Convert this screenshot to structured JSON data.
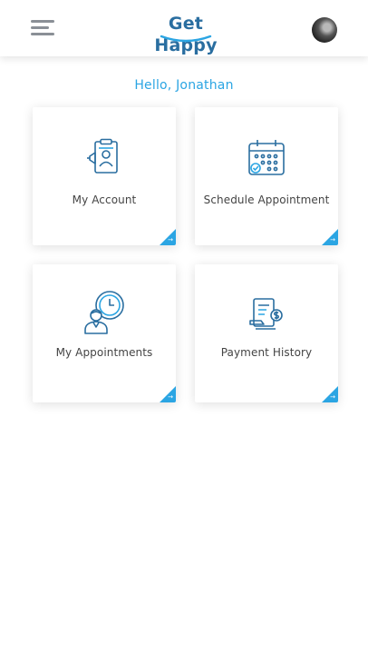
{
  "header": {
    "logo_text": "Get Happy",
    "menu_icon": "hamburger-menu-icon",
    "avatar_icon": "user-avatar"
  },
  "greeting": "Hello, Jonathan",
  "tiles": [
    {
      "label": "My Account",
      "icon": "account-id-card-icon"
    },
    {
      "label": "Schedule Appointment",
      "icon": "calendar-check-icon"
    },
    {
      "label": "My Appointments",
      "icon": "person-clock-icon"
    },
    {
      "label": "Payment History",
      "icon": "receipt-dollar-icon"
    }
  ],
  "colors": {
    "brand": "#2a6ea0",
    "accent": "#2ba5e3",
    "text": "#444444"
  }
}
